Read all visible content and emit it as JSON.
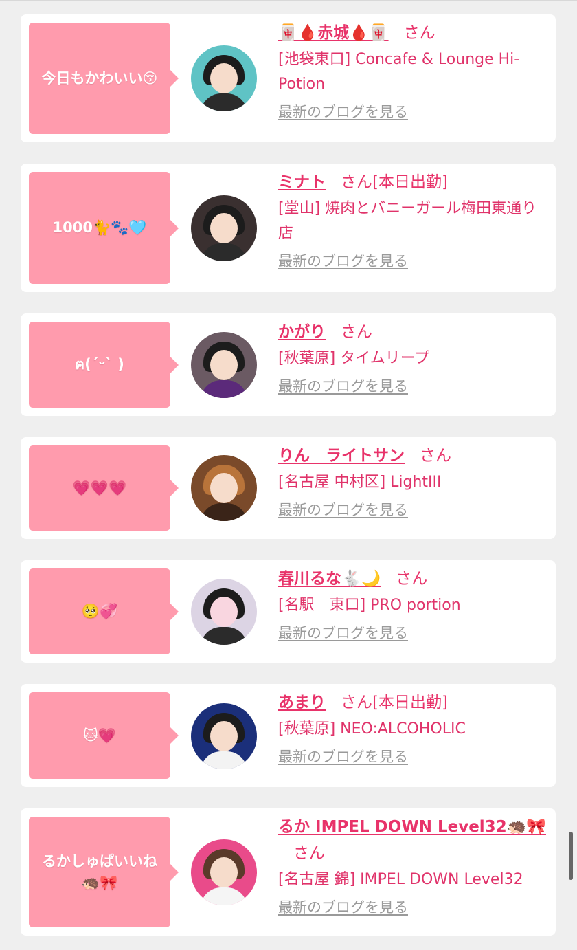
{
  "blog_link_label": "最新のブログを見る",
  "san_label": "さん",
  "cards": [
    {
      "bubble": "今日もかわいい😚",
      "name": "🀄🩸赤城🩸🀄",
      "suffix": "",
      "store": "[池袋東口] Concafe & Lounge Hi-Potion",
      "avatar_bg": "#5fc3c5"
    },
    {
      "bubble": "1000🐈🐾🩵",
      "name": "ミナト",
      "suffix": "[本日出勤]",
      "store": "[堂山] 焼肉とバニーガール梅田東通り店",
      "avatar_bg": "#3a3030"
    },
    {
      "bubble": "ฅ(ˊᵕˋ )",
      "name": "かがり",
      "suffix": "",
      "store": "[秋葉原] タイムリープ",
      "avatar_bg": "#6b5a63"
    },
    {
      "bubble": "💗💗💗",
      "name": "りん　ライトサン",
      "suffix": "",
      "store": "[名古屋 中村区] LightIII",
      "avatar_bg": "#7a4a2a"
    },
    {
      "bubble": "🥺💞",
      "name": "春川るな🐇🌙",
      "suffix": "",
      "store": "[名駅　東口] PRO portion",
      "avatar_bg": "#dcd4e4"
    },
    {
      "bubble": "🐱💗",
      "name": "あまり",
      "suffix": "[本日出勤]",
      "store": "[秋葉原] NEO:ALCOHOLIC",
      "avatar_bg": "#1b2f7a"
    },
    {
      "bubble": "るかしゅぱいいね🦔🎀",
      "name": "るか IMPEL DOWN Level32🦔🎀",
      "suffix": "",
      "store": "[名古屋 錦] IMPEL DOWN Level32",
      "avatar_bg": "#e94b8a"
    }
  ]
}
